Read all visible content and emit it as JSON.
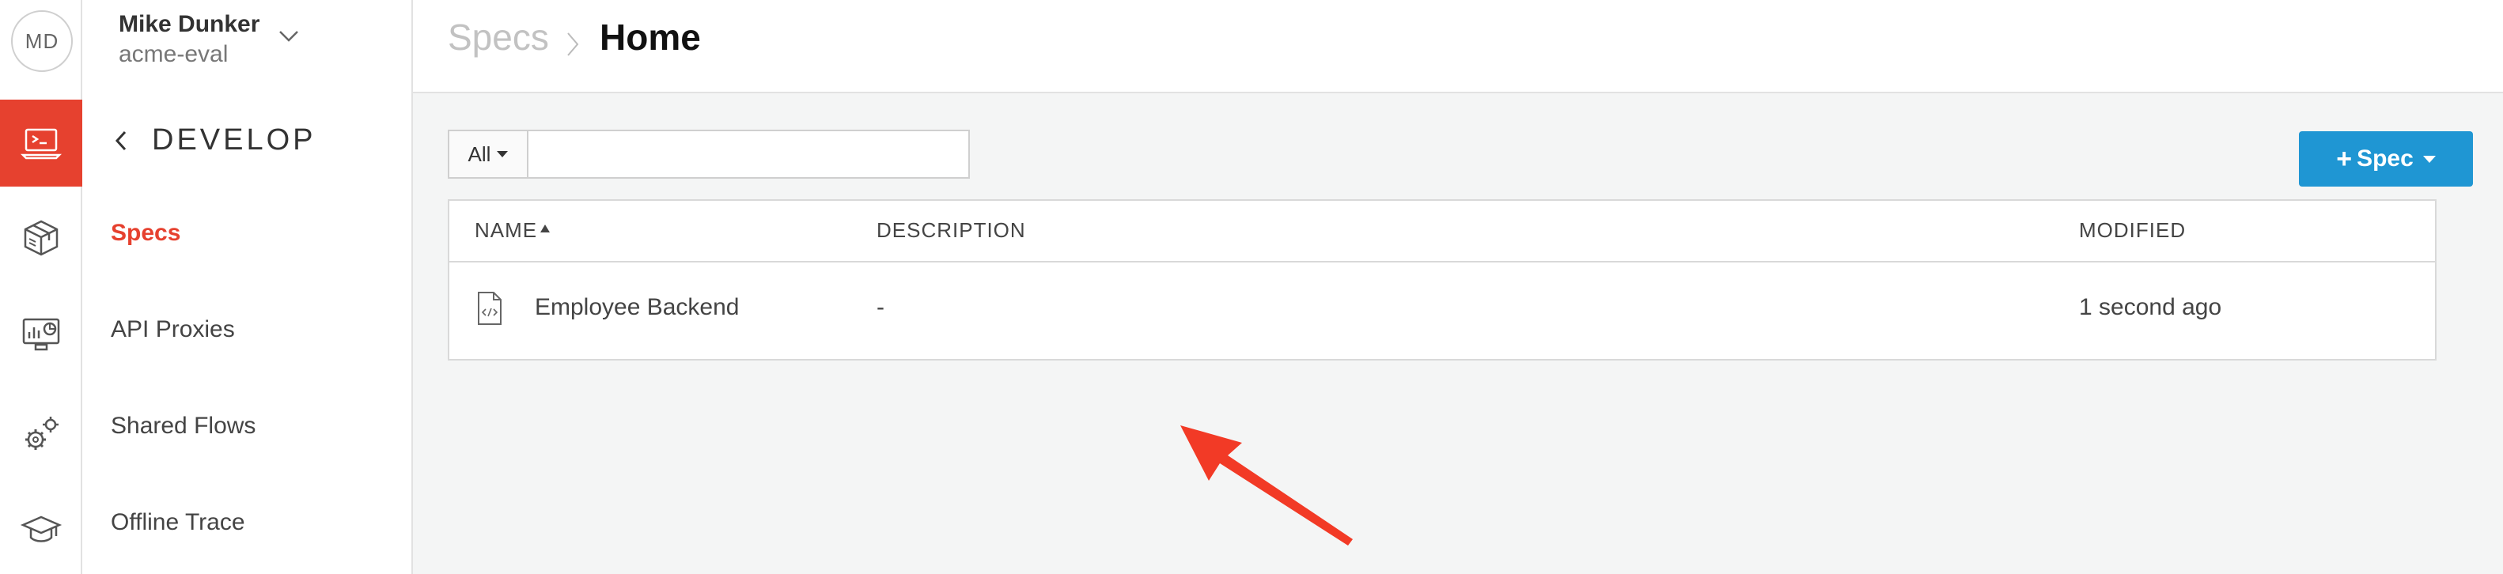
{
  "user": {
    "initials": "MD",
    "name": "Mike Dunker",
    "org": "acme-eval"
  },
  "rail": {
    "items": [
      {
        "icon": "terminal-laptop-icon",
        "active": true
      },
      {
        "icon": "package-box-icon",
        "active": false
      },
      {
        "icon": "monitor-analytics-icon",
        "active": false
      },
      {
        "icon": "gears-icon",
        "active": false
      },
      {
        "icon": "graduation-cap-icon",
        "active": false
      }
    ]
  },
  "nav": {
    "section_title": "DEVELOP",
    "items": [
      {
        "label": "Specs",
        "active": true
      },
      {
        "label": "API Proxies",
        "active": false
      },
      {
        "label": "Shared Flows",
        "active": false
      },
      {
        "label": "Offline Trace",
        "active": false
      }
    ]
  },
  "breadcrumb": {
    "parent": "Specs",
    "current": "Home"
  },
  "filter": {
    "selected": "All",
    "query": ""
  },
  "add_button": {
    "label": "Spec"
  },
  "table": {
    "columns": [
      "NAME",
      "DESCRIPTION",
      "MODIFIED"
    ],
    "rows": [
      {
        "name": "Employee Backend",
        "description": "-",
        "modified": "1 second ago"
      }
    ]
  },
  "colors": {
    "accent": "#e6412f",
    "primary_button": "#1f96d3",
    "annotation_arrow": "#f23a26"
  }
}
